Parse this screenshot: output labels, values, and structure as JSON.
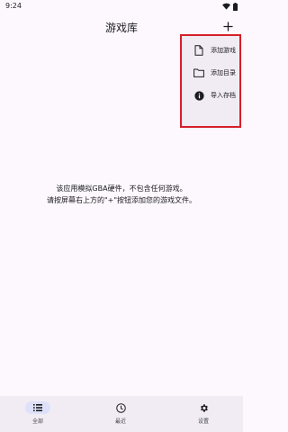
{
  "status_bar": {
    "time": "9:24"
  },
  "app_bar": {
    "title": "游戏库",
    "add_icon": "plus-icon"
  },
  "menu": {
    "items": [
      {
        "label": "添加游戏",
        "icon": "file-icon"
      },
      {
        "label": "添加目录",
        "icon": "folder-icon"
      },
      {
        "label": "导入存档",
        "icon": "info-icon"
      }
    ]
  },
  "empty_message": {
    "line1": "该应用模拟GBA硬件，不包含任何游戏。",
    "line2": "请按屏幕右上方的\"+\"按钮添加您的游戏文件。"
  },
  "nav": {
    "items": [
      {
        "label": "全部",
        "icon": "list-icon",
        "active": true
      },
      {
        "label": "最近",
        "icon": "clock-icon",
        "active": false
      },
      {
        "label": "设置",
        "icon": "gear-icon",
        "active": false
      }
    ]
  },
  "colors": {
    "highlight": "#d61f2a",
    "background": "#fcf8fd",
    "surface": "#f1ecf4",
    "active_indicator": "#dde1f9"
  }
}
